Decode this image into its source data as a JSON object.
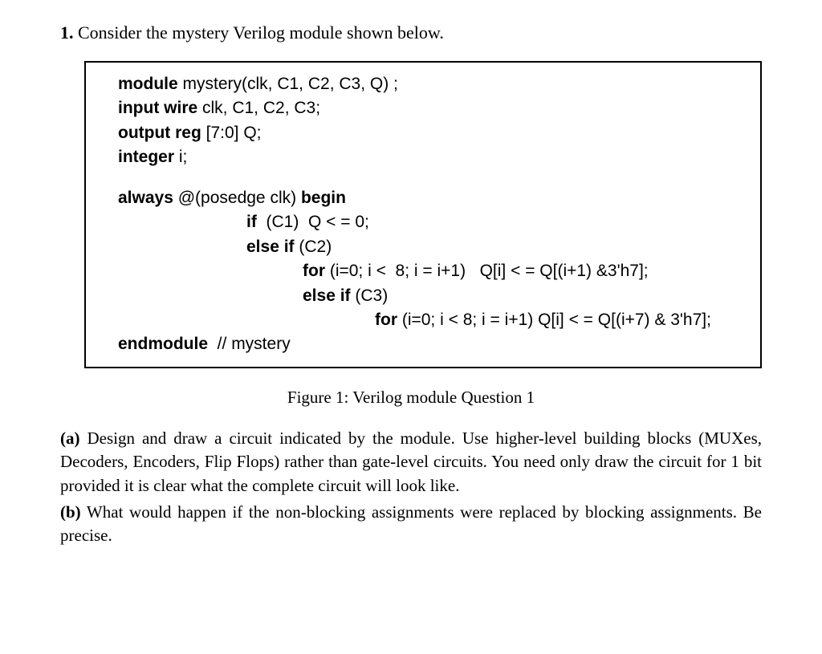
{
  "question": {
    "number": "1.",
    "prompt": "Consider the mystery Verilog module shown below."
  },
  "code": {
    "l1_kw1": "module",
    "l1_rest": " mystery(clk, C1, C2, C3, Q) ;",
    "l2_kw1": "input wire",
    "l2_rest": " clk, C1, C2, C3;",
    "l3_kw1": "output reg",
    "l3_rest": " [7:0] Q;",
    "l4_kw1": "integer",
    "l4_rest": " i;",
    "l5_kw1": "always",
    "l5_mid": " @(posedge clk) ",
    "l5_kw2": "begin",
    "l6_kw1": "if",
    "l6_rest": "  (C1)  Q < = 0;",
    "l7_kw1": "else if",
    "l7_rest": " (C2)",
    "l8_kw1": "for",
    "l8_rest": " (i=0; i <  8; i = i+1)   Q[i] < = Q[(i+1) &3'h7];",
    "l9_kw1": "else if",
    "l9_rest": " (C3)",
    "l10_kw1": "for",
    "l10_rest": " (i=0; i < 8; i = i+1) Q[i] < = Q[(i+7) & 3'h7];",
    "l11_kw1": "endmodule",
    "l11_rest": "  // mystery"
  },
  "figure": {
    "caption": "Figure 1: Verilog module Question 1"
  },
  "subparts": {
    "a_label": "(a)",
    "a_text": " Design and draw a circuit indicated by the module. Use higher-level building blocks (MUXes, Decoders, Encoders, Flip Flops) rather than gate-level circuits. You need only draw the circuit for 1 bit provided it is clear what the complete circuit will look like.",
    "b_label": "(b)",
    "b_text": " What would happen if the non-blocking assignments were replaced by blocking assignments. Be precise."
  }
}
